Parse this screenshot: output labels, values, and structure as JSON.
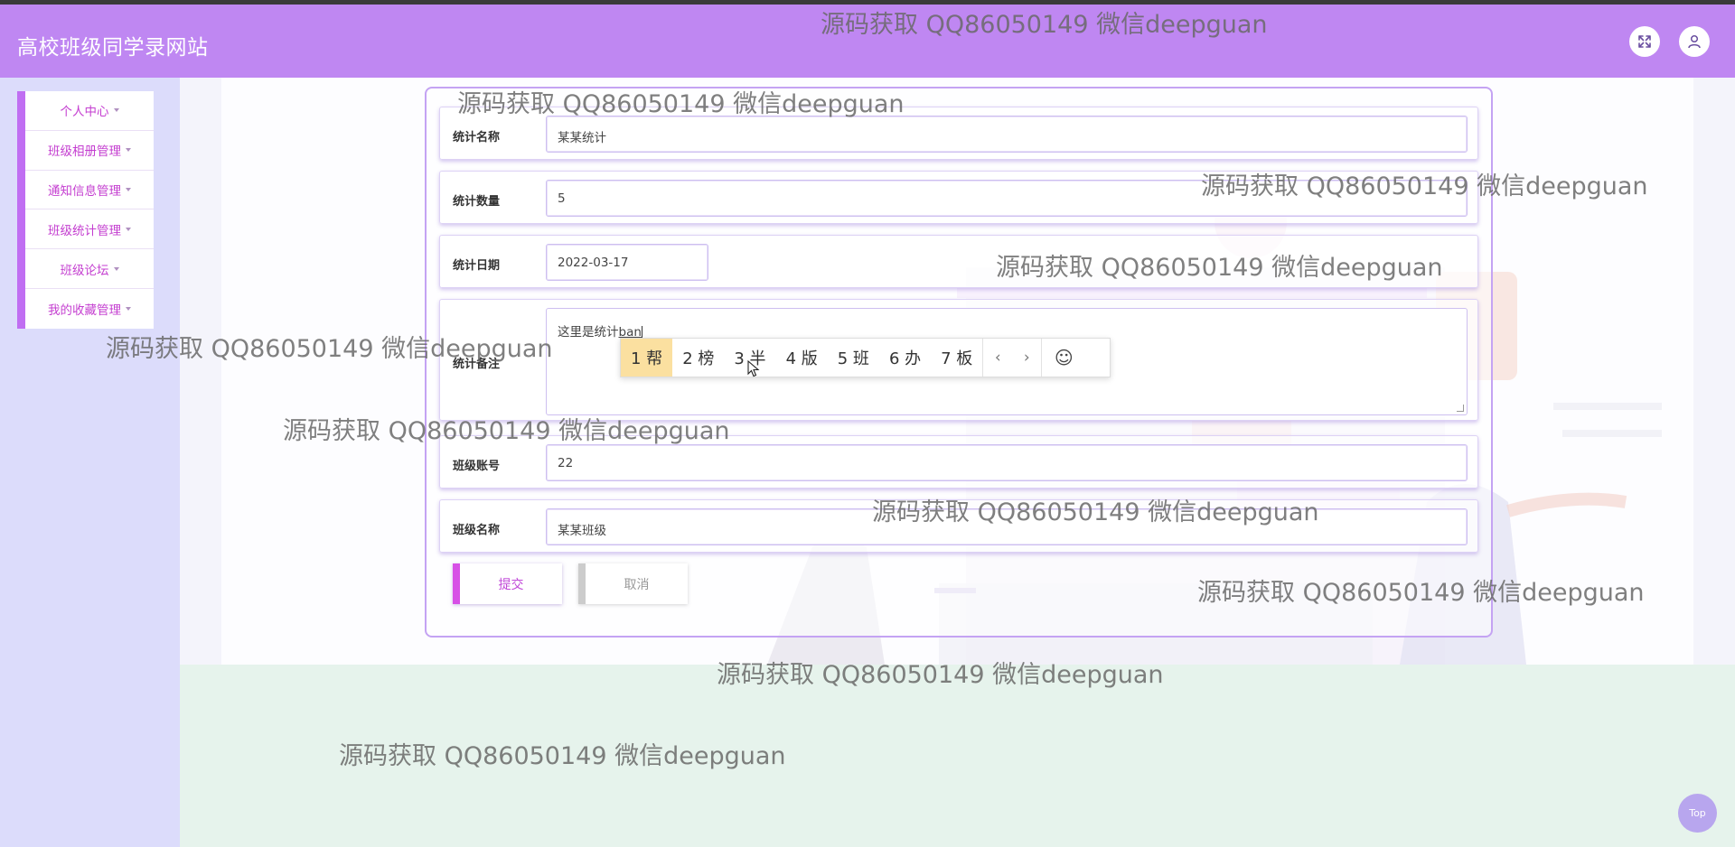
{
  "header": {
    "site_title": "高校班级同学录网站",
    "buttons": [
      {
        "icon": "fullscreen-icon"
      },
      {
        "icon": "user-icon"
      }
    ]
  },
  "sidebar": {
    "items": [
      {
        "label": "个人中心"
      },
      {
        "label": "班级相册管理"
      },
      {
        "label": "通知信息管理"
      },
      {
        "label": "班级统计管理"
      },
      {
        "label": "班级论坛"
      },
      {
        "label": "我的收藏管理"
      }
    ]
  },
  "form": {
    "fields": [
      {
        "label": "统计名称",
        "value": "某某统计"
      },
      {
        "label": "统计数量",
        "value": "5"
      },
      {
        "label": "统计日期",
        "value": "2022-03-17"
      },
      {
        "label": "统计备注",
        "value_committed": "这里是统计",
        "value_composing": "ban"
      },
      {
        "label": "班级账号",
        "value": "22"
      },
      {
        "label": "班级名称",
        "value": "某某班级"
      }
    ],
    "submit_label": "提交",
    "cancel_label": "取消"
  },
  "ime": {
    "candidates": [
      "1 帮",
      "2 榜",
      "3 半",
      "4 版",
      "5 班",
      "6 办",
      "7 板"
    ],
    "prev": "‹",
    "next": "›",
    "emoji": "☺"
  },
  "watermark_text": "源码获取 QQ86050149 微信deepguan",
  "top_button_label": "Top",
  "colors": {
    "header": "#bf87f2",
    "accent": "#c43ed0",
    "sidebar_bg": "#dcdcfb",
    "footer_bg": "#e6f3ec"
  }
}
